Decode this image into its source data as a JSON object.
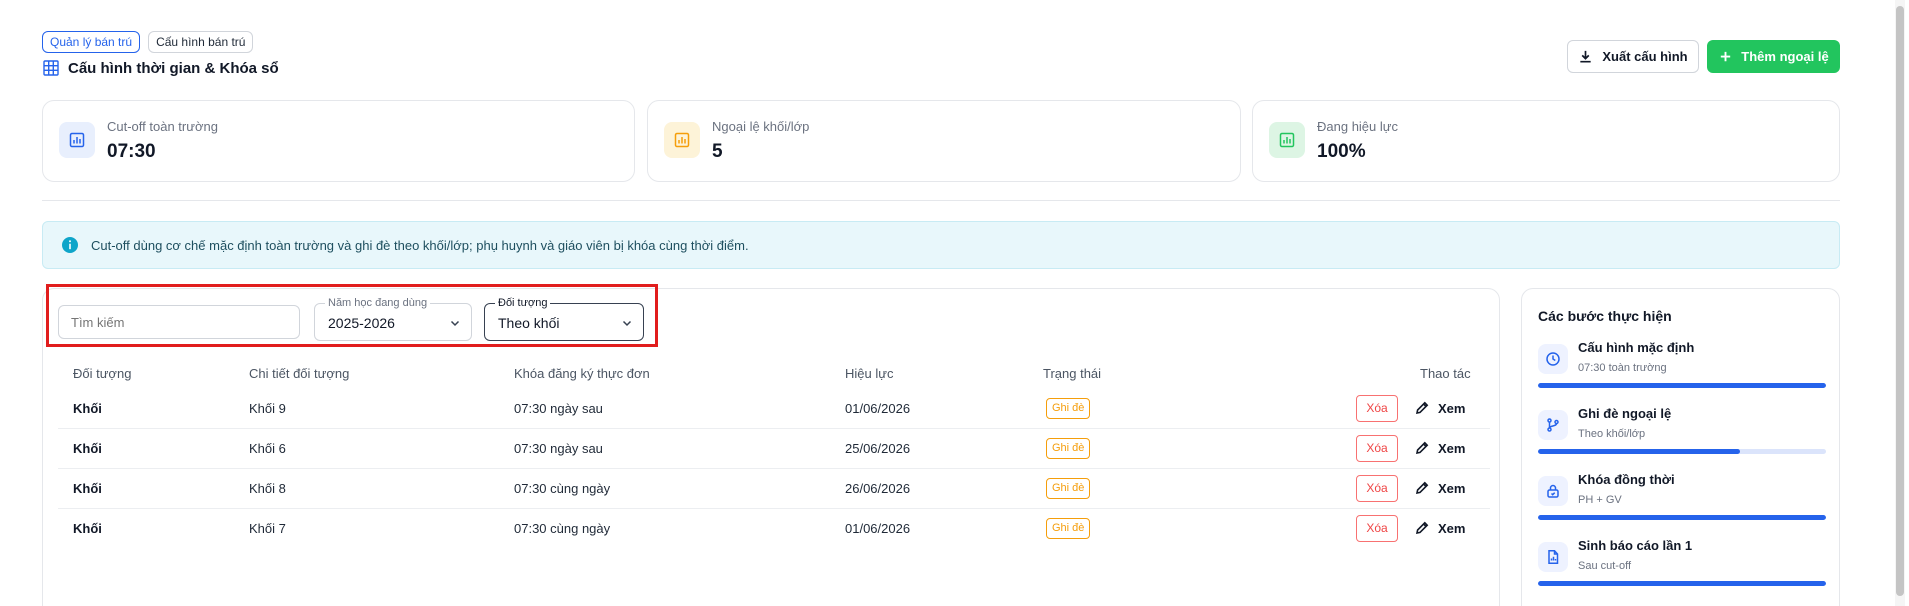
{
  "breadcrumb": {
    "items": [
      "Quản lý bán trú",
      "Cấu hình bán trú"
    ]
  },
  "header": {
    "title": "Cấu hình thời gian & Khóa sổ",
    "export_label": "Xuất cấu hình",
    "add_label": "Thêm ngoại lệ"
  },
  "stats": [
    {
      "label": "Cut-off toàn trường",
      "value": "07:30",
      "color": "#2563eb"
    },
    {
      "label": "Ngoại lệ khối/lớp",
      "value": "5",
      "color": "#f59e0b"
    },
    {
      "label": "Đang hiệu lực",
      "value": "100%",
      "color": "#22c55e"
    }
  ],
  "banner": {
    "text": "Cut-off dùng cơ chế mặc định toàn trường và ghi đè theo khối/lớp; phụ huynh và giáo viên bị khóa cùng thời điểm."
  },
  "filters": {
    "search_placeholder": "Tìm kiếm",
    "year": {
      "label": "Năm học đang dùng",
      "value": "2025-2026"
    },
    "target": {
      "label": "Đối tượng",
      "value": "Theo khối"
    }
  },
  "table": {
    "headers": [
      "Đối tượng",
      "Chi tiết đối tượng",
      "Khóa đăng ký thực đơn",
      "Hiệu lực",
      "Trạng thái",
      "Thao tác"
    ],
    "rows": [
      {
        "target": "Khối",
        "detail": "Khối 9",
        "lock": "07:30 ngày sau",
        "effective": "01/06/2026",
        "status": "Ghi đè",
        "delete": "Xóa",
        "view": "Xem"
      },
      {
        "target": "Khối",
        "detail": "Khối 6",
        "lock": "07:30 ngày sau",
        "effective": "25/06/2026",
        "status": "Ghi đè",
        "delete": "Xóa",
        "view": "Xem"
      },
      {
        "target": "Khối",
        "detail": "Khối 8",
        "lock": "07:30 cùng ngày",
        "effective": "26/06/2026",
        "status": "Ghi đè",
        "delete": "Xóa",
        "view": "Xem"
      },
      {
        "target": "Khối",
        "detail": "Khối 7",
        "lock": "07:30 cùng ngày",
        "effective": "01/06/2026",
        "status": "Ghi đè",
        "delete": "Xóa",
        "view": "Xem"
      }
    ]
  },
  "steps": {
    "title": "Các bước thực hiện",
    "items": [
      {
        "title": "Cấu hình mặc định",
        "subtitle": "07:30 toàn trường",
        "icon": "clock-icon",
        "progress": 1.0
      },
      {
        "title": "Ghi đè ngoại lệ",
        "subtitle": "Theo khối/lớp",
        "icon": "branch-icon",
        "progress": 0.7
      },
      {
        "title": "Khóa đồng thời",
        "subtitle": "PH + GV",
        "icon": "lock-icon",
        "progress": 1.0
      },
      {
        "title": "Sinh báo cáo lần 1",
        "subtitle": "Sau cut-off",
        "icon": "report-icon",
        "progress": 1.0
      }
    ]
  },
  "colors": {
    "accent": "#2563eb",
    "success": "#22c55e",
    "warning": "#f59e0b",
    "danger": "#ef4444",
    "highlight": "#e11d1d"
  }
}
